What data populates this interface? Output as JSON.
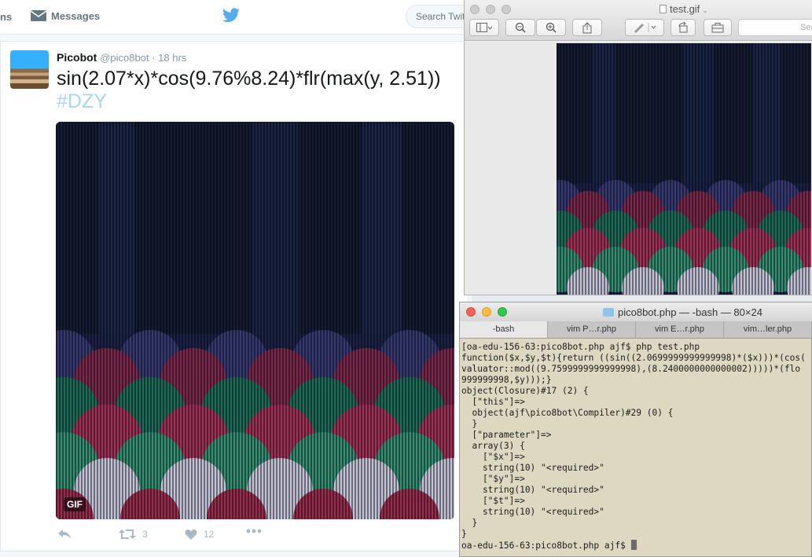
{
  "twitter": {
    "nav_fragment": "ns",
    "messages_label": "Messages",
    "search_placeholder": "Search Twitter",
    "tweet": {
      "name": "Picobot",
      "handle": "@pico8bot",
      "separator": " · ",
      "time": "18 hrs",
      "text": "sin(2.07*x)*cos(9.76%8.24)*flr(max(y, 2.51))",
      "hashtag": "#DZY",
      "gif_badge": "GIF",
      "retweet_count": "3",
      "like_count": "12"
    }
  },
  "preview": {
    "filename": "test.gif",
    "search_placeholder": "Sea"
  },
  "terminal": {
    "title": "pico8bot.php — -bash — 80×24",
    "tabs": [
      "-bash",
      "vim P…r.php",
      "vim E…r.php",
      "vim…ler.php"
    ],
    "lines": [
      "[oa-edu-156-63:pico8bot.php ajf$ php test.php",
      "function($x,$y,$t){return ((sin((2.0699999999999998)*($x)))*(cos(",
      "valuator::mod((9.7599999999999998),(8.2400000000000002)))))*(flo",
      "999999998,$y)));}",
      "object(Closure)#17 (2) {",
      "  [\"this\"]=>",
      "  object(ajf\\pico8bot\\Compiler)#29 (0) {",
      "  }",
      "  [\"parameter\"]=>",
      "  array(3) {",
      "    [\"$x\"]=>",
      "    string(10) \"<required>\"",
      "    [\"$y\"]=>",
      "    string(10) \"<required>\"",
      "    [\"$t\"]=>",
      "    string(10) \"<required>\"",
      "  }",
      "}",
      "oa-edu-156-63:pico8bot.php ajf$ "
    ]
  }
}
